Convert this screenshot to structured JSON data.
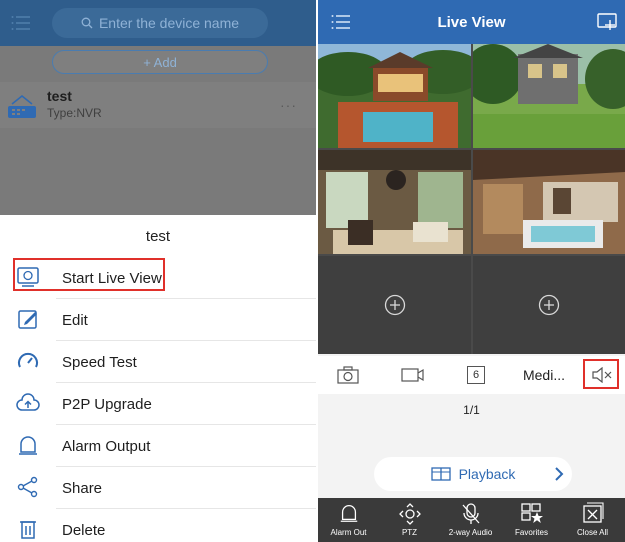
{
  "left": {
    "search_placeholder": "Enter the device name",
    "add_label": "+ Add",
    "device": {
      "name": "test",
      "type": "Type:NVR",
      "more": "···"
    },
    "sheet": {
      "title": "test",
      "items": [
        {
          "label": "Start Live View",
          "icon": "live-view-icon"
        },
        {
          "label": "Edit",
          "icon": "edit-icon"
        },
        {
          "label": "Speed Test",
          "icon": "speedometer-icon"
        },
        {
          "label": "P2P Upgrade",
          "icon": "cloud-upgrade-icon"
        },
        {
          "label": "Alarm Output",
          "icon": "alarm-bell-icon"
        },
        {
          "label": "Share",
          "icon": "share-icon"
        },
        {
          "label": "Delete",
          "icon": "trash-icon"
        }
      ]
    }
  },
  "right": {
    "title": "Live View",
    "toolbar": {
      "stream_label": "Medi...",
      "split_count": "6"
    },
    "page_indicator": "1/1",
    "playback_label": "Playback",
    "bottom_bar": [
      {
        "label": "Alarm Out",
        "icon": "alarm-bell-icon"
      },
      {
        "label": "PTZ",
        "icon": "ptz-icon"
      },
      {
        "label": "2-way Audio",
        "icon": "mic-off-icon"
      },
      {
        "label": "Favorites",
        "icon": "favorites-icon"
      },
      {
        "label": "Close All",
        "icon": "close-all-icon"
      }
    ]
  },
  "colors": {
    "header_left": "#2f5d8c",
    "header_right": "#2f6ab3",
    "highlight": "#e0302a",
    "accent": "#2f6ab3"
  }
}
